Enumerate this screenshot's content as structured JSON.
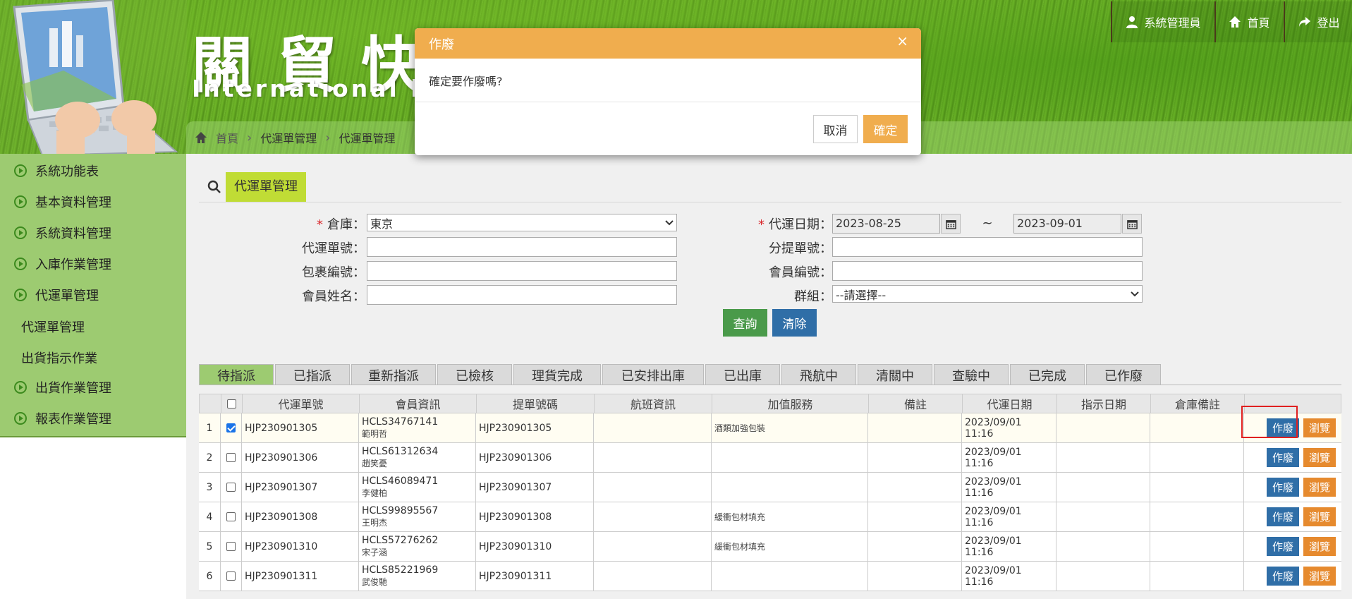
{
  "banner": {
    "title": "關貿快",
    "subtitle": "International logis"
  },
  "topnav": {
    "admin": "系統管理員",
    "home": "首頁",
    "logout": "登出"
  },
  "breadcrumb": [
    "首頁",
    "代運單管理",
    "代運單管理"
  ],
  "sidebar": {
    "items": [
      {
        "label": "系統功能表"
      },
      {
        "label": "基本資料管理"
      },
      {
        "label": "系統資料管理"
      },
      {
        "label": "入庫作業管理"
      },
      {
        "label": "代運單管理"
      }
    ],
    "subitems": [
      {
        "label": "代運單管理"
      },
      {
        "label": "出貨指示作業"
      }
    ],
    "items2": [
      {
        "label": "出貨作業管理"
      },
      {
        "label": "報表作業管理"
      }
    ]
  },
  "section": {
    "title": "代運單管理"
  },
  "form": {
    "warehouse_label": "倉庫：",
    "warehouse_value": "東京",
    "waybill_no_label": "代運單號：",
    "package_no_label": "包裹編號：",
    "member_name_label": "會員姓名：",
    "date_label": "代運日期：",
    "date_from": "2023-08-25",
    "date_tilde": "~",
    "date_to": "2023-09-01",
    "sub_bill_label": "分提單號：",
    "member_no_label": "會員編號：",
    "group_label": "群組：",
    "group_value": "--請選擇--",
    "query_button": "查詢",
    "clear_button": "清除"
  },
  "tabs": [
    "待指派",
    "已指派",
    "重新指派",
    "已檢核",
    "理貨完成",
    "已安排出庫",
    "已出庫",
    "飛航中",
    "清關中",
    "查驗中",
    "已完成",
    "已作廢"
  ],
  "active_tab": "待指派",
  "table": {
    "headers": [
      "代運單號",
      "會員資訊",
      "提單號碼",
      "航班資訊",
      "加值服務",
      "備註",
      "代運日期",
      "指示日期",
      "倉庫備註"
    ],
    "action_cancel": "作廢",
    "action_view": "瀏覽",
    "rows": [
      {
        "idx": "1",
        "checked": true,
        "waybill": "HJP230901305",
        "member_id": "HCLS34767141",
        "member_name": "範明哲",
        "bill": "HJP230901305",
        "flight": "",
        "service": "酒類加強包裝",
        "remark": "",
        "date": "2023/09/01",
        "time": "11:16",
        "indicate": "",
        "wh_remark": ""
      },
      {
        "idx": "2",
        "checked": false,
        "waybill": "HJP230901306",
        "member_id": "HCLS61312634",
        "member_name": "趙笑憂",
        "bill": "HJP230901306",
        "flight": "",
        "service": "",
        "remark": "",
        "date": "2023/09/01",
        "time": "11:16",
        "indicate": "",
        "wh_remark": ""
      },
      {
        "idx": "3",
        "checked": false,
        "waybill": "HJP230901307",
        "member_id": "HCLS46089471",
        "member_name": "李健柏",
        "bill": "HJP230901307",
        "flight": "",
        "service": "",
        "remark": "",
        "date": "2023/09/01",
        "time": "11:16",
        "indicate": "",
        "wh_remark": ""
      },
      {
        "idx": "4",
        "checked": false,
        "waybill": "HJP230901308",
        "member_id": "HCLS99895567",
        "member_name": "王明杰",
        "bill": "HJP230901308",
        "flight": "",
        "service": "緩衝包材填充",
        "remark": "",
        "date": "2023/09/01",
        "time": "11:16",
        "indicate": "",
        "wh_remark": ""
      },
      {
        "idx": "5",
        "checked": false,
        "waybill": "HJP230901310",
        "member_id": "HCLS57276262",
        "member_name": "宋子涵",
        "bill": "HJP230901310",
        "flight": "",
        "service": "緩衝包材填充",
        "remark": "",
        "date": "2023/09/01",
        "time": "11:16",
        "indicate": "",
        "wh_remark": ""
      },
      {
        "idx": "6",
        "checked": false,
        "waybill": "HJP230901311",
        "member_id": "HCLS85221969",
        "member_name": "武俊馳",
        "bill": "HJP230901311",
        "flight": "",
        "service": "",
        "remark": "",
        "date": "2023/09/01",
        "time": "11:16",
        "indicate": "",
        "wh_remark": ""
      }
    ]
  },
  "modal": {
    "title": "作廢",
    "close": "×",
    "message": "確定要作廢嗎?",
    "cancel_button": "取消",
    "confirm_button": "確定"
  },
  "colors": {
    "sidebar_bg": "#9dcb71",
    "modal_header": "#f0ad4e",
    "query_button": "#4a9a4a",
    "clear_button": "#2f6ea7",
    "cancel_action": "#2f6ea7",
    "view_action": "#e68a2e",
    "highlight": "#e02020"
  }
}
